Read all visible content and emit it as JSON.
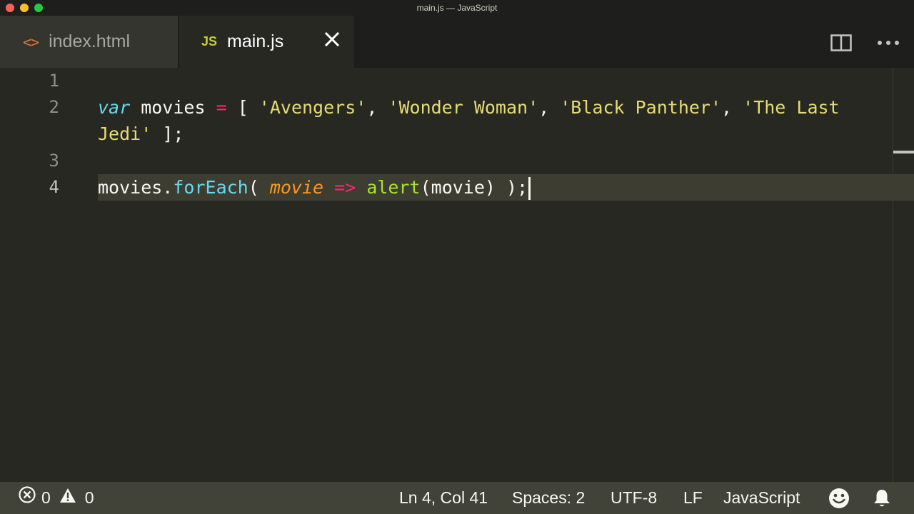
{
  "window": {
    "title": "main.js — JavaScript"
  },
  "tabs": [
    {
      "label": "index.html",
      "icon": "html-code-icon",
      "icon_text": "<>",
      "active": false
    },
    {
      "label": "main.js",
      "icon": "js-file-icon",
      "icon_text": "JS",
      "active": true,
      "close_glyph": "✕"
    }
  ],
  "editor_actions": {
    "split": "split-editor-icon",
    "more": "more-actions-icon"
  },
  "editor": {
    "line_numbers": [
      "1",
      "2",
      "3",
      "4"
    ],
    "current_line": "4",
    "lines": {
      "line2a": {
        "kw_var": "var",
        "name": " movies ",
        "eq": "=",
        "open": " [ ",
        "s1": "'Avengers'",
        "c1": ", ",
        "s2": "'Wonder Woman'",
        "c2": ", ",
        "s3": "'Black Panther'",
        "c3": ", ",
        "s4a": "'The Last"
      },
      "line2b": {
        "s4b": "Jedi'",
        "close": " ];"
      },
      "line4": {
        "obj": "movies.",
        "method": "forEach",
        "open": "( ",
        "param": "movie",
        "sp1": " ",
        "arrow": "=>",
        "sp2": " ",
        "call": "alert",
        "args": "(movie) );"
      }
    }
  },
  "colors": {
    "background": "#272822",
    "keyword": "#66d9ef",
    "operator": "#f92672",
    "string": "#e6db74",
    "parameter": "#fd971f",
    "function_call": "#a6e22e",
    "statusbar": "#414339"
  },
  "statusbar": {
    "errors": "0",
    "warnings": "0",
    "position": "Ln 4, Col 41",
    "indent": "Spaces: 2",
    "encoding": "UTF-8",
    "eol": "LF",
    "language": "JavaScript",
    "feedback_icon": "smiley-icon",
    "notifications_icon": "bell-icon"
  }
}
